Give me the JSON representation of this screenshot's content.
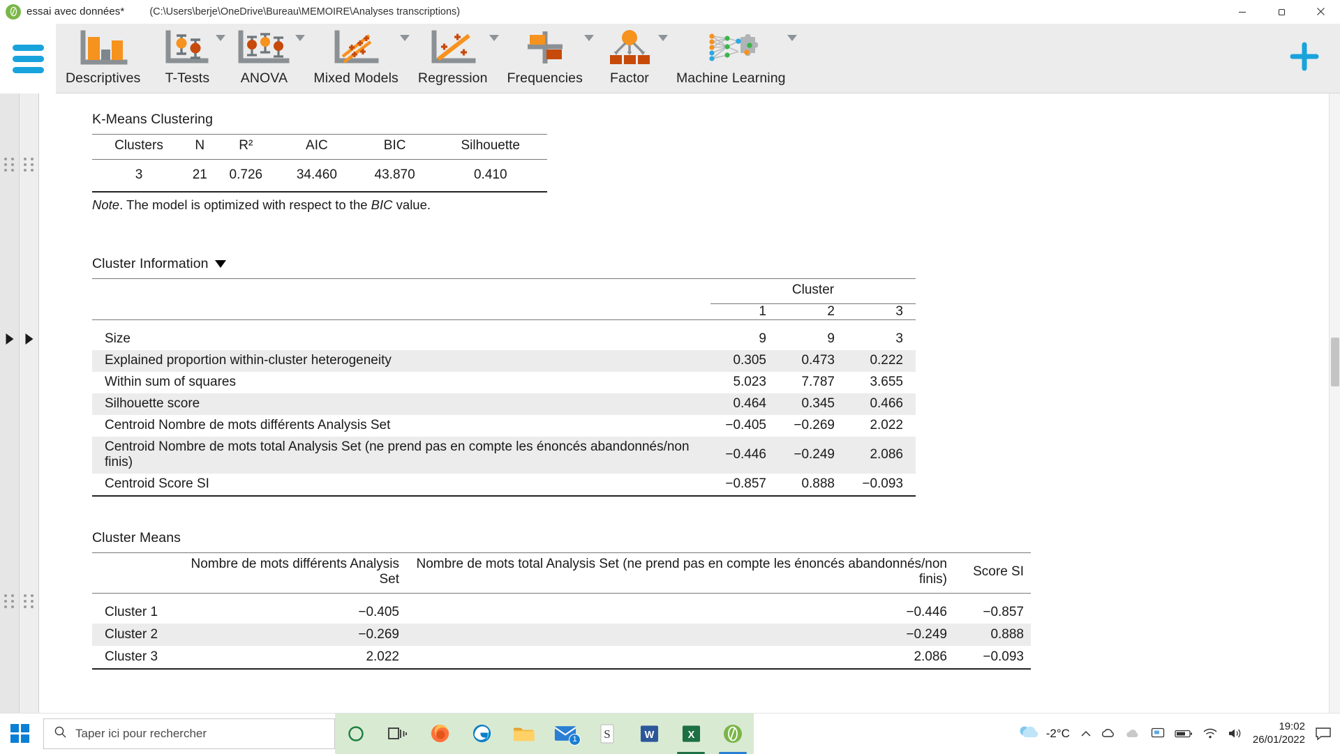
{
  "window": {
    "logo_icon": "jasp-logo-icon",
    "filename": "essai avec données*",
    "path": "(C:\\Users\\berje\\OneDrive\\Bureau\\MEMOIRE\\Analyses transcriptions)",
    "minimize_icon": "minimize-icon",
    "restore_icon": "restore-icon",
    "close_icon": "close-icon"
  },
  "ribbon": {
    "menu_icon": "hamburger-menu-icon",
    "add_icon": "plus-icon",
    "items": [
      {
        "label": "Descriptives",
        "icon": "bar-chart-icon",
        "has_caret": false
      },
      {
        "label": "T-Tests",
        "icon": "t-test-icon",
        "has_caret": true
      },
      {
        "label": "ANOVA",
        "icon": "anova-icon",
        "has_caret": true
      },
      {
        "label": "Mixed Models",
        "icon": "mixed-models-icon",
        "has_caret": true
      },
      {
        "label": "Regression",
        "icon": "regression-icon",
        "has_caret": true
      },
      {
        "label": "Frequencies",
        "icon": "frequencies-icon",
        "has_caret": true
      },
      {
        "label": "Factor",
        "icon": "factor-icon",
        "has_caret": true
      },
      {
        "label": "Machine Learning",
        "icon": "machine-learning-icon",
        "has_caret": true
      }
    ]
  },
  "results": {
    "kmeans": {
      "title": "K-Means Clustering",
      "columns": [
        "Clusters",
        "N",
        "R²",
        "AIC",
        "BIC",
        "Silhouette"
      ],
      "row": [
        "3",
        "21",
        "0.726",
        "34.460",
        "43.870",
        "0.410"
      ],
      "note_prefix": "Note",
      "note_text_a": ". The model is optimized with respect to the ",
      "note_em": "BIC",
      "note_text_b": " value."
    },
    "cluster_information": {
      "title": "Cluster Information",
      "collapse_icon": "triangle-down-icon",
      "group_header": "Cluster",
      "cluster_ids": [
        "1",
        "2",
        "3"
      ],
      "rows": [
        {
          "label": "Size",
          "values": [
            "9",
            "9",
            "3"
          ]
        },
        {
          "label": "Explained proportion within-cluster heterogeneity",
          "values": [
            "0.305",
            "0.473",
            "0.222"
          ]
        },
        {
          "label": "Within sum of squares",
          "values": [
            "5.023",
            "7.787",
            "3.655"
          ]
        },
        {
          "label": "Silhouette score",
          "values": [
            "0.464",
            "0.345",
            "0.466"
          ]
        },
        {
          "label": "Centroid Nombre de mots différents Analysis Set",
          "values": [
            "−0.405",
            "−0.269",
            "2.022"
          ]
        },
        {
          "label": "Centroid Nombre de mots total Analysis Set (ne prend pas en compte les énoncés abandonnés/non finis)",
          "values": [
            "−0.446",
            "−0.249",
            "2.086"
          ]
        },
        {
          "label": "Centroid Score SI",
          "values": [
            "−0.857",
            "0.888",
            "−0.093"
          ]
        }
      ]
    },
    "cluster_means": {
      "title": "Cluster Means",
      "columns": [
        "",
        "Nombre de mots différents Analysis Set",
        "Nombre de mots total Analysis Set (ne prend pas en compte les énoncés abandonnés/non finis)",
        "Score SI"
      ],
      "rows": [
        {
          "label": "Cluster 1",
          "values": [
            "−0.405",
            "−0.446",
            "−0.857"
          ]
        },
        {
          "label": "Cluster 2",
          "values": [
            "−0.269",
            "−0.249",
            "0.888"
          ]
        },
        {
          "label": "Cluster 3",
          "values": [
            "2.022",
            "2.086",
            "−0.093"
          ]
        }
      ]
    }
  },
  "taskbar": {
    "start_icon": "windows-start-icon",
    "search": {
      "icon": "search-icon",
      "placeholder": "Taper ici pour rechercher",
      "value": ""
    },
    "apps": [
      {
        "name": "cortana-icon",
        "label": "Cortana"
      },
      {
        "name": "task-view-icon",
        "label": "Task View"
      },
      {
        "name": "firefox-icon",
        "label": "Firefox"
      },
      {
        "name": "edge-icon",
        "label": "Microsoft Edge"
      },
      {
        "name": "file-explorer-icon",
        "label": "File Explorer"
      },
      {
        "name": "mail-icon",
        "label": "Mail",
        "badge": "1"
      },
      {
        "name": "sumatra-pdf-icon",
        "label": "Sumatra PDF"
      },
      {
        "name": "word-icon",
        "label": "Word"
      },
      {
        "name": "excel-icon",
        "label": "Excel"
      },
      {
        "name": "jasp-icon",
        "label": "JASP"
      }
    ],
    "tray": {
      "weather_icon": "cloud-icon",
      "temperature": "-2°C",
      "chevron_icon": "chevron-up-icon",
      "onedrive_icon": "onedrive-icon",
      "cloud_icon": "cloud-sync-icon",
      "display_icon": "display-icon",
      "battery_icon": "battery-icon",
      "wifi_icon": "wifi-icon",
      "volume_icon": "volume-icon",
      "time": "19:02",
      "date": "26/01/2022",
      "notification_icon": "notification-icon"
    }
  },
  "colors": {
    "accent_blue": "#19a3dc",
    "ribbon_bg": "#ececec",
    "orange": "#f6921e",
    "dark_orange": "#c74a0b",
    "jasp_green": "#7ab648",
    "alt_row": "#ececec"
  }
}
